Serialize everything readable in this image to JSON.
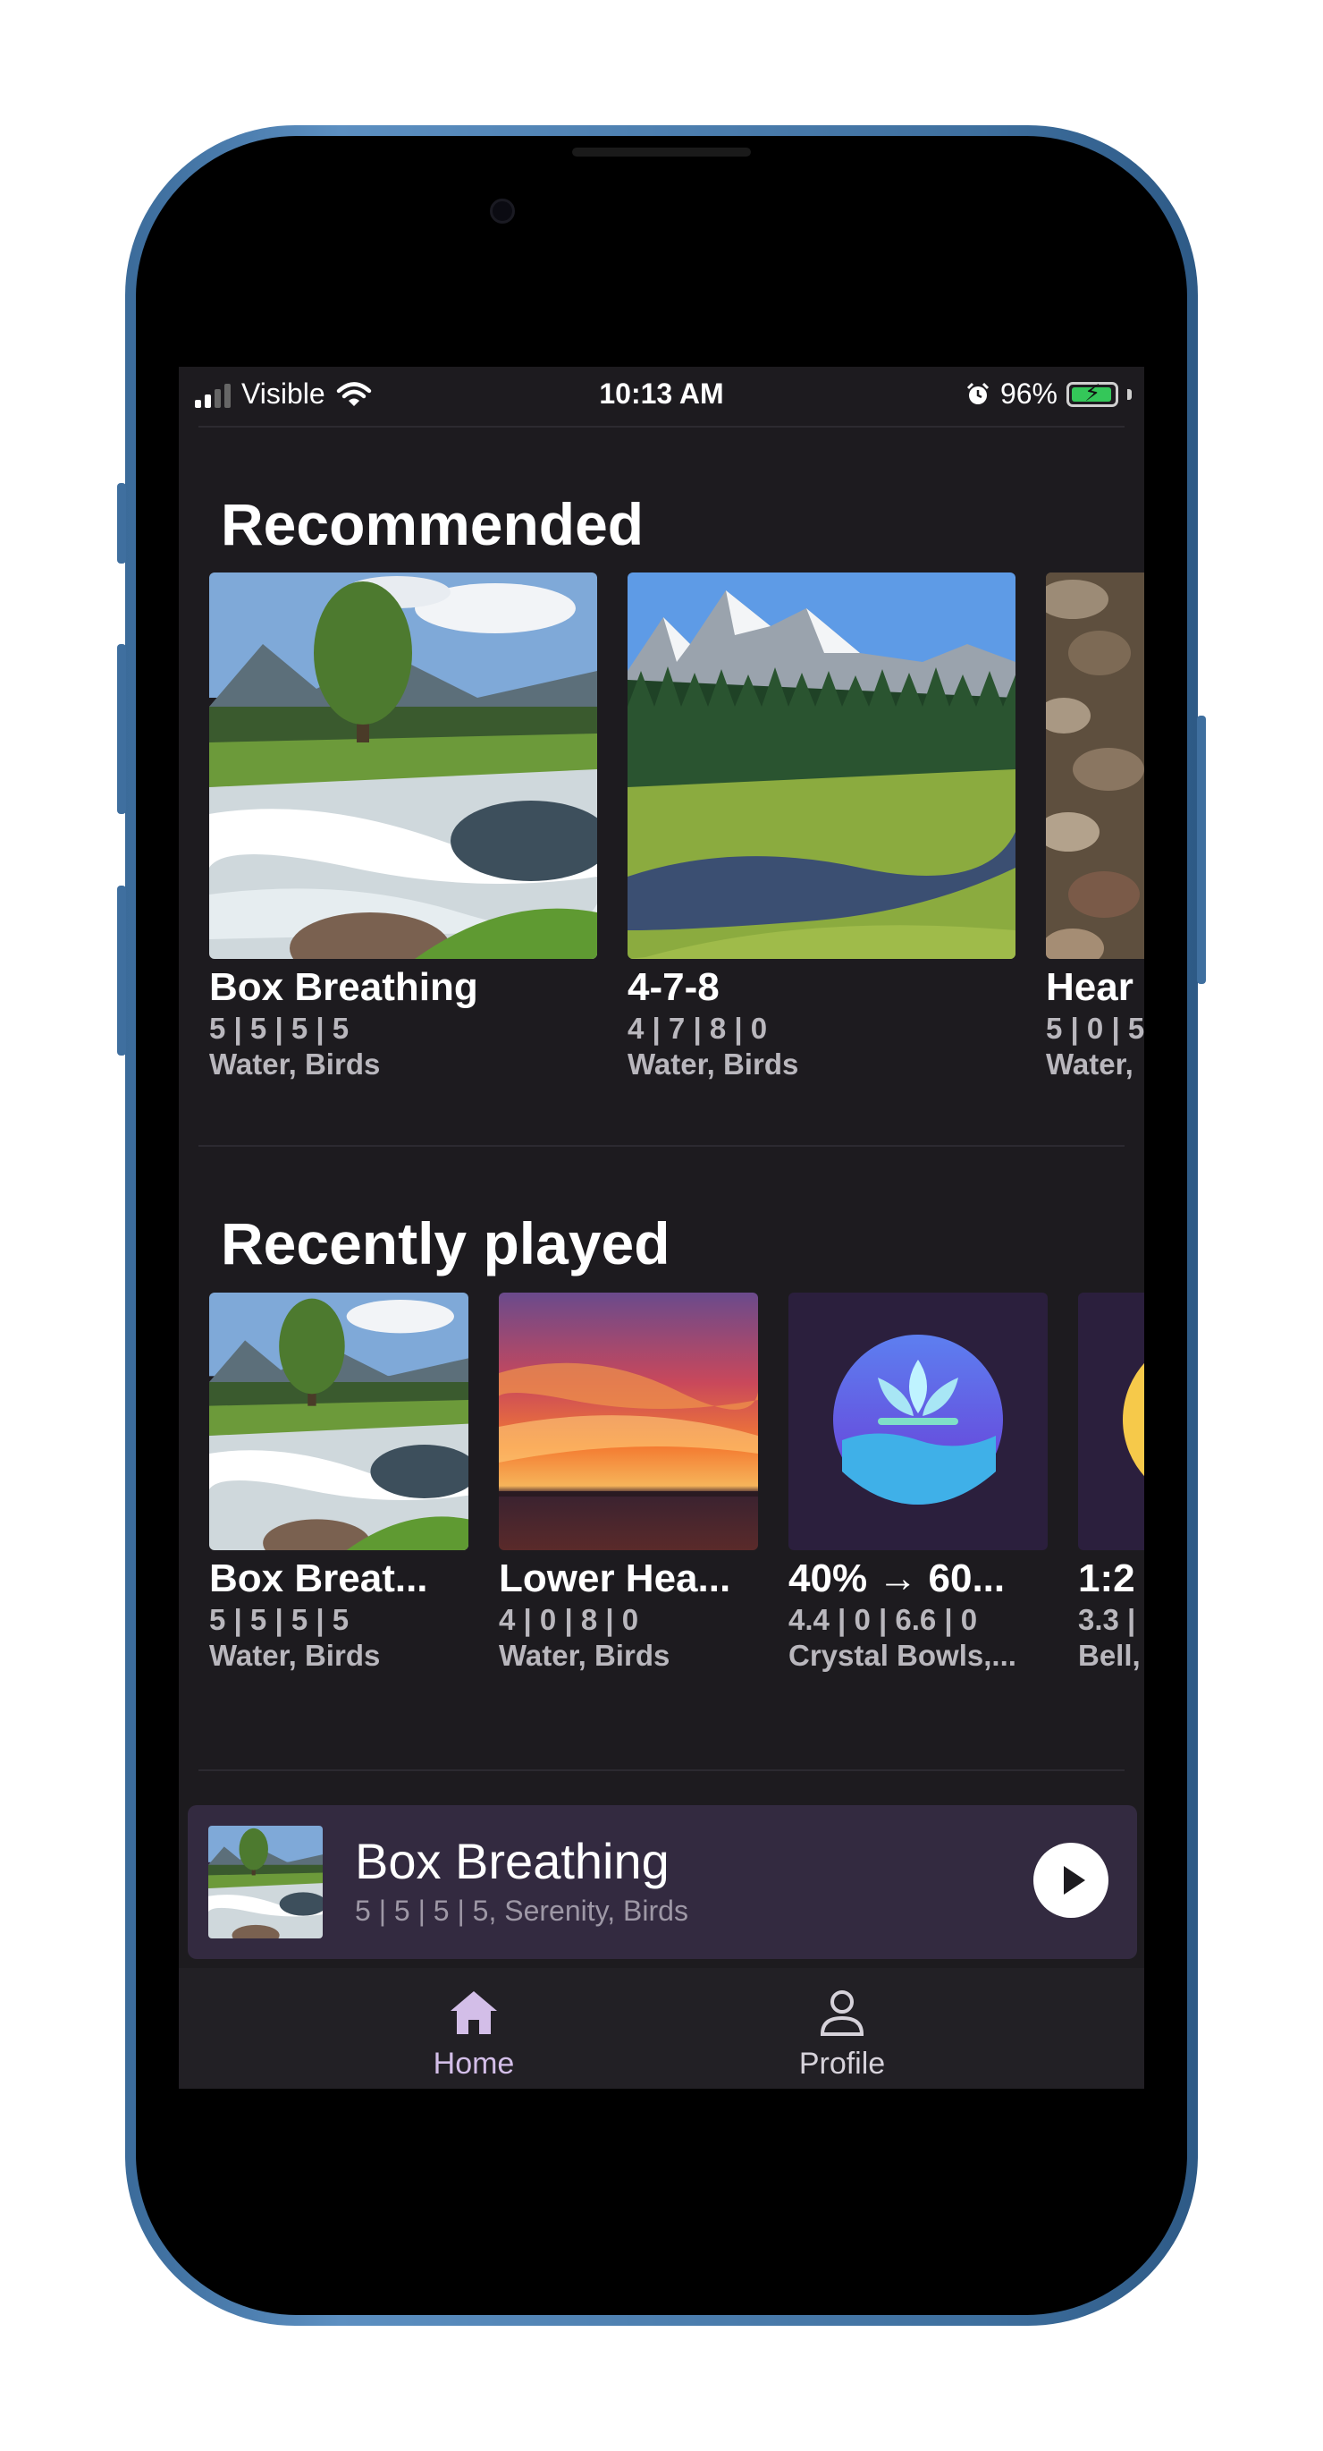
{
  "status_bar": {
    "carrier": "Visible",
    "time": "10:13 AM",
    "battery_percent": "96%",
    "battery_level": 0.96,
    "icons": [
      "signal-icon",
      "wifi-icon",
      "alarm-icon",
      "battery-charging-icon"
    ]
  },
  "recommended": {
    "title": "Recommended",
    "items": [
      {
        "title": "Box Breathing",
        "pattern": "5 | 5 | 5 | 5",
        "sounds": "Water, Birds",
        "image": "river-scene"
      },
      {
        "title": "4-7-8",
        "pattern": "4 | 7 | 8 | 0",
        "sounds": "Water, Birds",
        "image": "mountain-lake-scene"
      },
      {
        "title": "Hear",
        "pattern": "5 | 0 | 5",
        "sounds": "Water,",
        "image": "pebbles-scene"
      }
    ]
  },
  "recently_played": {
    "title": "Recently played",
    "items": [
      {
        "title": "Box Breat...",
        "pattern": "5 | 5 | 5 | 5",
        "sounds": "Water, Birds",
        "image": "river-scene"
      },
      {
        "title": "Lower Hea...",
        "pattern": "4 | 0 | 8 | 0",
        "sounds": "Water, Birds",
        "image": "sunset-scene"
      },
      {
        "title": "40% → 60...",
        "pattern": "4.4 | 0 | 6.6 | 0",
        "sounds": "Crystal Bowls,...",
        "image": "lotus-icon"
      },
      {
        "title": "1:2",
        "pattern": "3.3 |",
        "sounds": "Bell,",
        "image": "sun-icon"
      }
    ]
  },
  "mini_player": {
    "title": "Box Breathing",
    "subtitle": "5 | 5 | 5 | 5, Serenity, Birds",
    "icon": "play-icon"
  },
  "nav": {
    "items": [
      {
        "label": "Home",
        "icon": "home-icon",
        "active": true
      },
      {
        "label": "Profile",
        "icon": "profile-icon",
        "active": false
      }
    ]
  },
  "colors": {
    "background": "#1d1b1f",
    "accent": "#d3bee8",
    "player_bg": "#332a40",
    "nav_bg": "#222025",
    "battery": "#34c759"
  }
}
